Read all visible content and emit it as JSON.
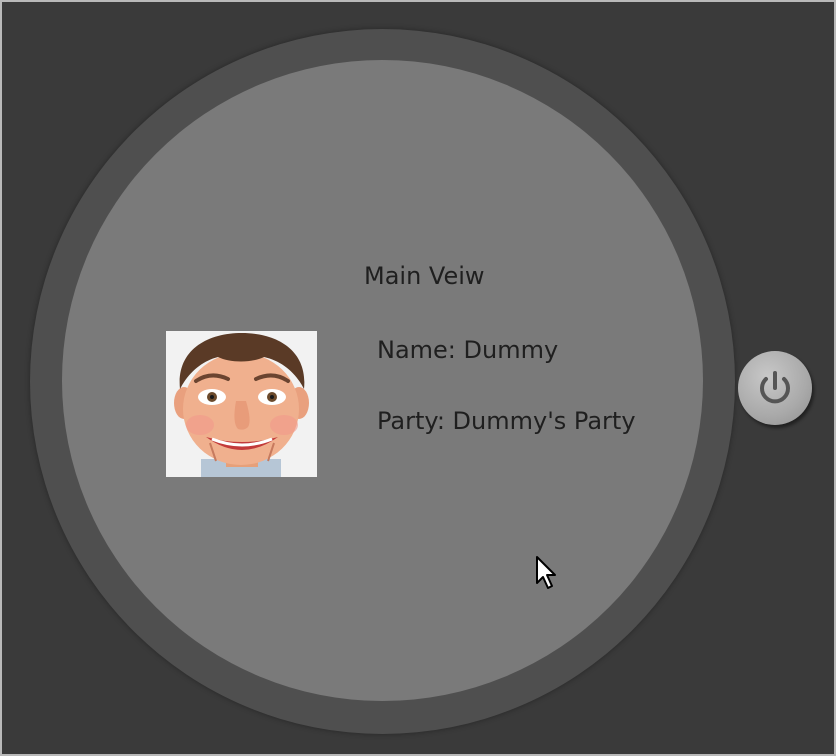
{
  "screen": {
    "title": "Main Veiw",
    "name_label": "Name: Dummy",
    "party_label": "Party: Dummy's Party"
  },
  "controls": {
    "power_icon": "power-icon"
  },
  "colors": {
    "background": "#3a3a3a",
    "bezel": "#4f4f4f",
    "face": "#7a7a7a",
    "text": "#1f1f1f",
    "button": "#a9a9a9"
  }
}
